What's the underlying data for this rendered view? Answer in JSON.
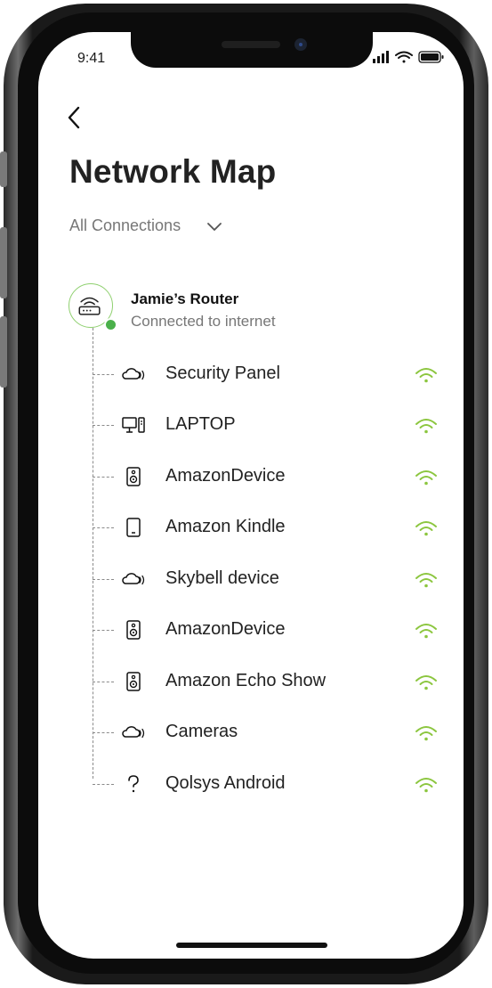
{
  "status_bar": {
    "time": "9:41",
    "icons": [
      "cellular-signal-icon",
      "wifi-icon",
      "battery-icon"
    ]
  },
  "header": {
    "back_icon": "chevron-left-icon",
    "title": "Network Map"
  },
  "filter": {
    "selected": "All Connections",
    "icon": "chevron-down-icon"
  },
  "router": {
    "icon": "router-icon",
    "name": "Jamie’s Router",
    "status": "Connected to internet",
    "status_color": "#4ab04a"
  },
  "devices": [
    {
      "label": "Security Panel",
      "icon": "cloud-wireless-icon",
      "signal": "wifi-strong-icon"
    },
    {
      "label": "LAPTOP",
      "icon": "computer-icon",
      "signal": "wifi-strong-icon"
    },
    {
      "label": "AmazonDevice",
      "icon": "speaker-icon",
      "signal": "wifi-strong-icon"
    },
    {
      "label": "Amazon Kindle",
      "icon": "tablet-icon",
      "signal": "wifi-strong-icon"
    },
    {
      "label": "Skybell device",
      "icon": "cloud-wireless-icon",
      "signal": "wifi-strong-icon"
    },
    {
      "label": "AmazonDevice",
      "icon": "speaker-icon",
      "signal": "wifi-strong-icon"
    },
    {
      "label": "Amazon Echo Show",
      "icon": "speaker-icon",
      "signal": "wifi-strong-icon"
    },
    {
      "label": "Cameras",
      "icon": "cloud-wireless-icon",
      "signal": "wifi-strong-icon"
    },
    {
      "label": "Qolsys Android",
      "icon": "unknown-device-icon",
      "signal": "wifi-strong-icon"
    }
  ],
  "colors": {
    "accent_green": "#8cc63f",
    "router_ring": "#8fd06f"
  }
}
